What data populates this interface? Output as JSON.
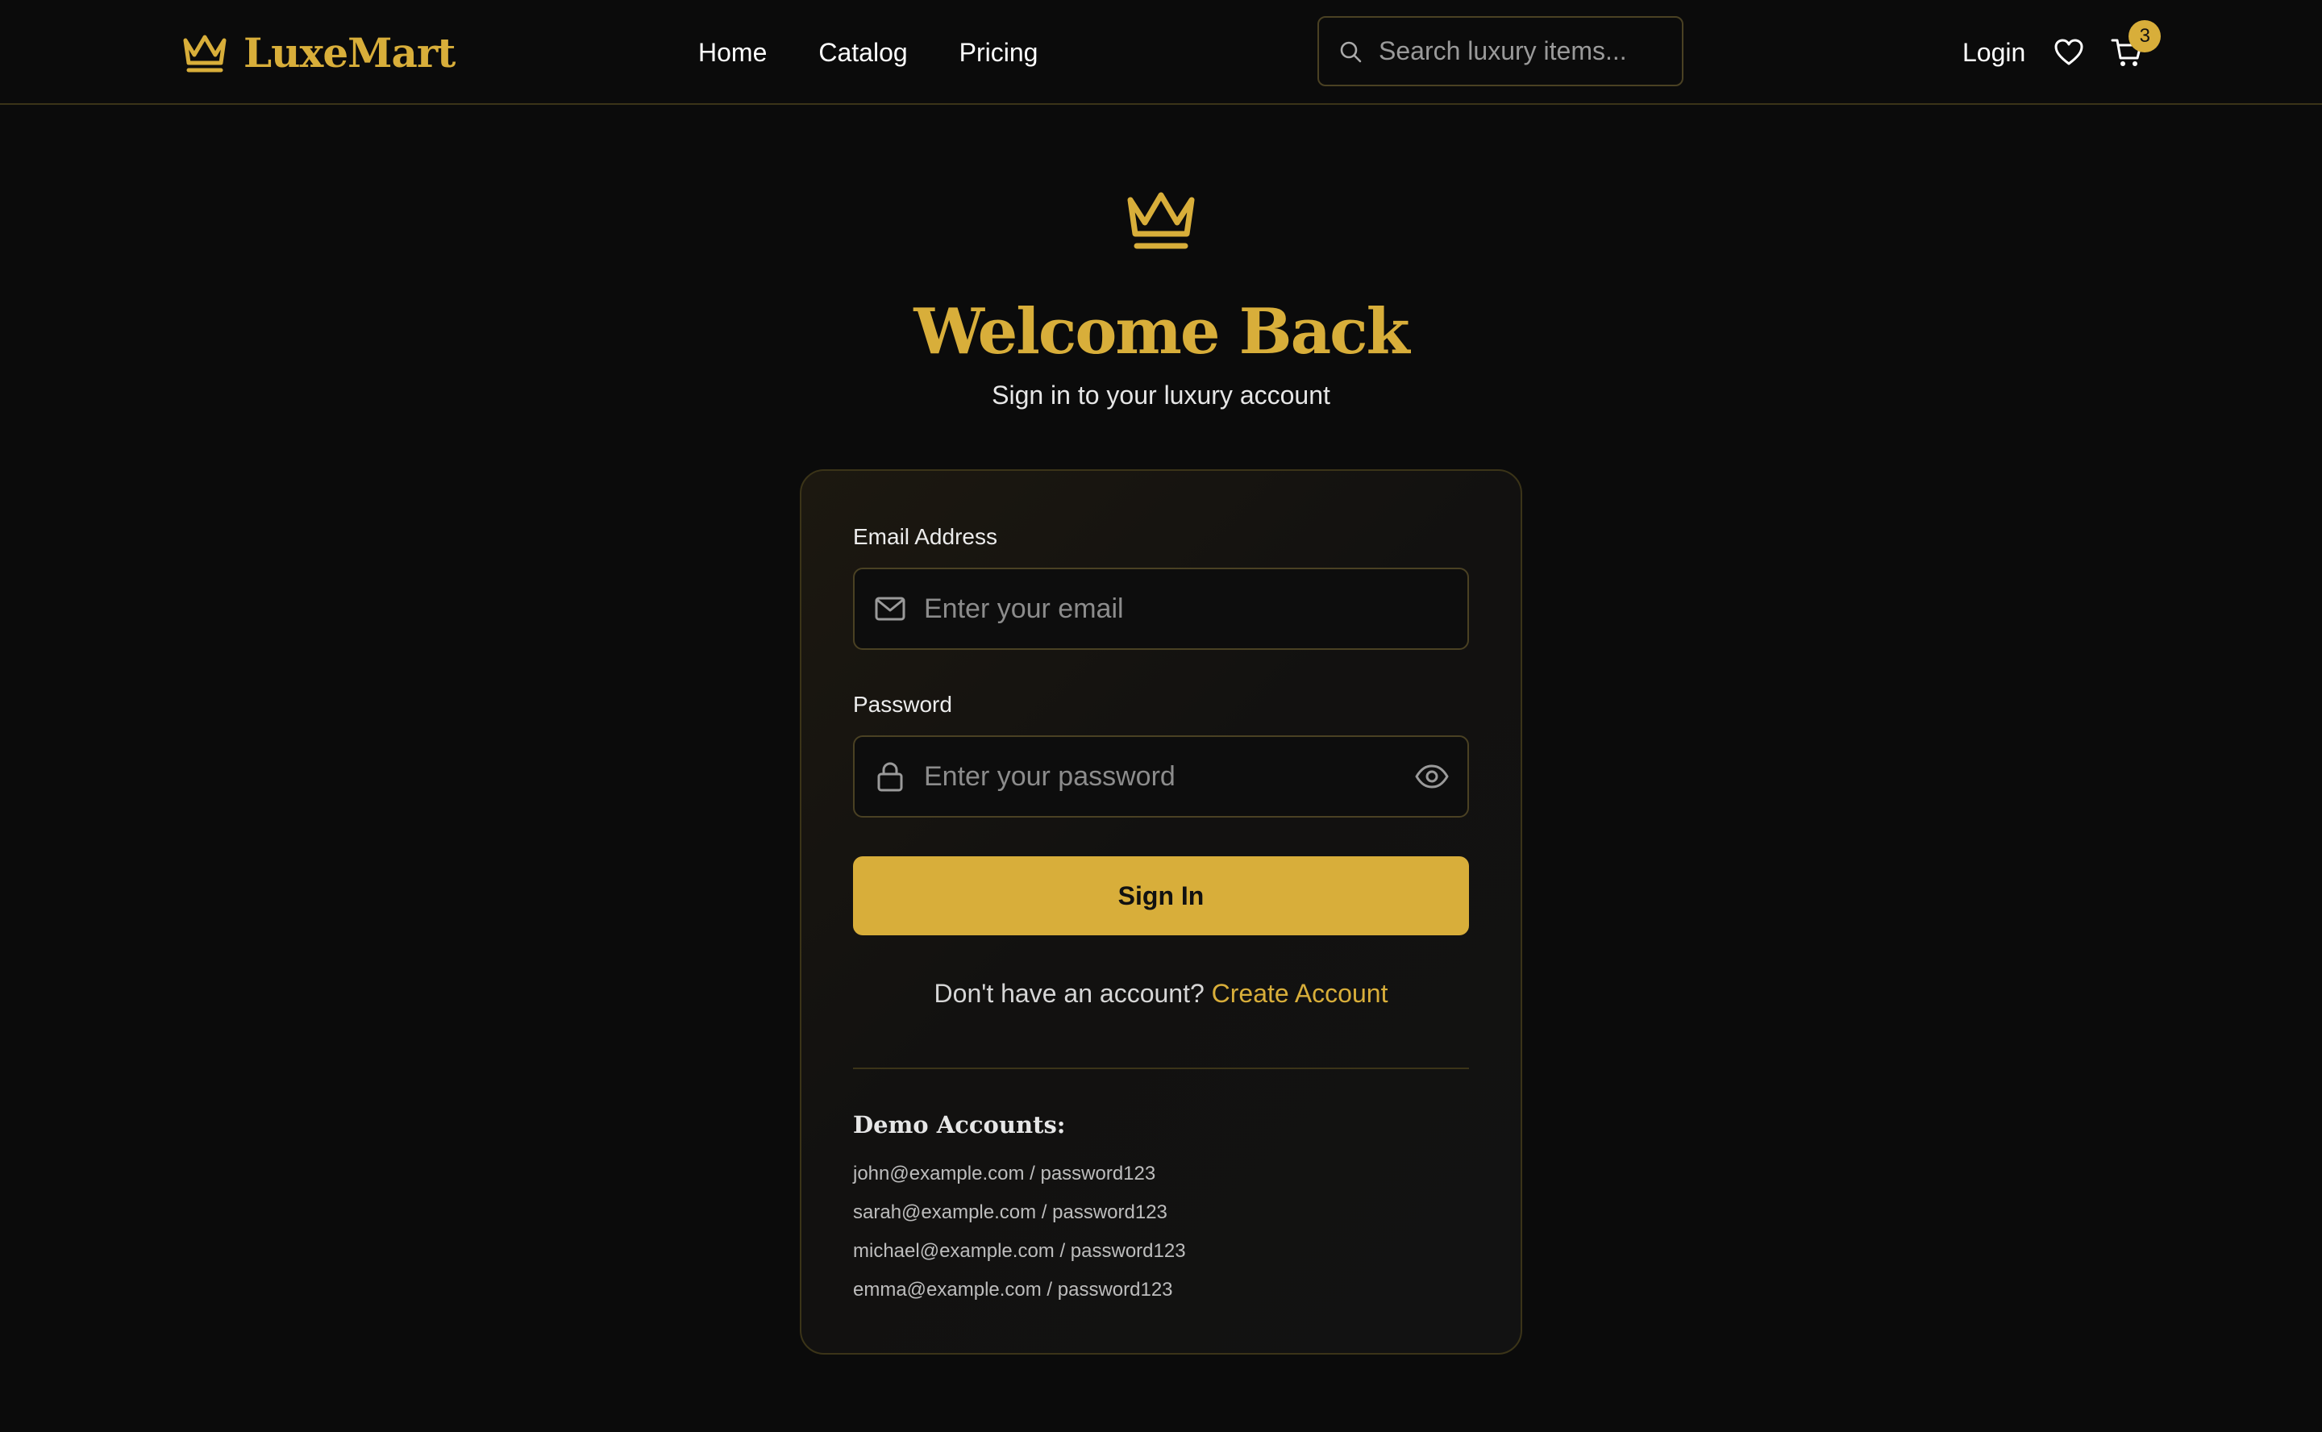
{
  "header": {
    "brand": "LuxeMart",
    "nav": [
      "Home",
      "Catalog",
      "Pricing"
    ],
    "search_placeholder": "Search luxury items...",
    "login_label": "Login",
    "cart_count": "3"
  },
  "main": {
    "title": "Welcome Back",
    "subtitle": "Sign in to your luxury account"
  },
  "form": {
    "email_label": "Email Address",
    "email_placeholder": "Enter your email",
    "email_value": "",
    "password_label": "Password",
    "password_placeholder": "Enter your password",
    "password_value": "",
    "submit_label": "Sign In",
    "signup_prompt": "Don't have an account?",
    "signup_link": "Create Account"
  },
  "demo": {
    "title": "Demo Accounts:",
    "accounts": [
      "john@example.com / password123",
      "sarah@example.com / password123",
      "michael@example.com / password123",
      "emma@example.com / password123"
    ]
  },
  "icons": {
    "brand": "crown-icon",
    "search": "search-icon",
    "wishlist": "heart-icon",
    "cart": "cart-icon",
    "email": "mail-icon",
    "password": "lock-icon",
    "toggle_password": "eye-icon"
  },
  "colors": {
    "accent": "#d8ae3a",
    "background": "#0b0b0b",
    "card": "#141210",
    "border": "#3b3418"
  }
}
